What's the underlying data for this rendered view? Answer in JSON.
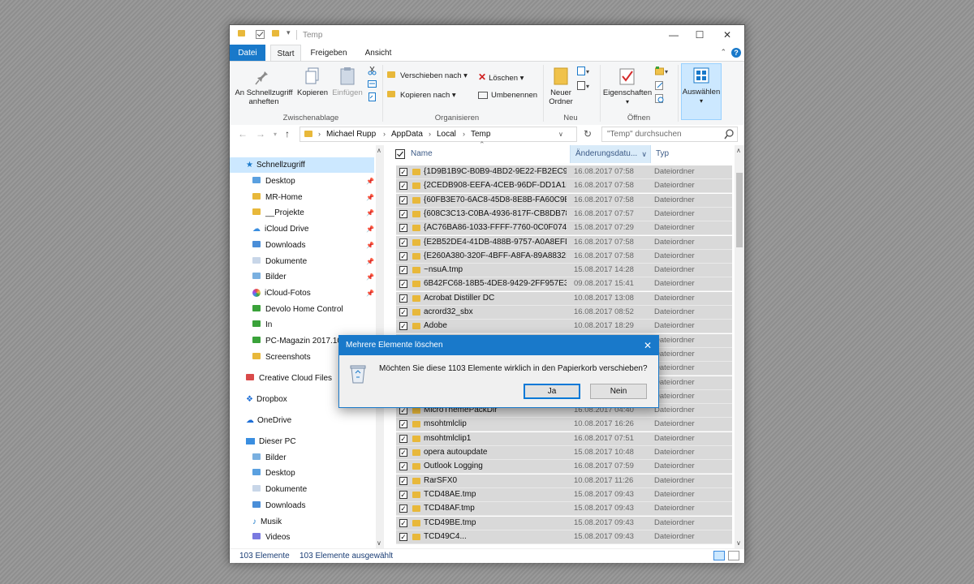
{
  "window": {
    "title": "Temp",
    "buttons": {
      "minimize": "—",
      "maximize": "☐",
      "close": "✕"
    }
  },
  "ribbon": {
    "tabs": [
      "Datei",
      "Start",
      "Freigeben",
      "Ansicht"
    ],
    "active_tab": "Start",
    "clipboard": {
      "pin_label_1": "An Schnellzugriff",
      "pin_label_2": "anheften",
      "copy": "Kopieren",
      "paste": "Einfügen",
      "group": "Zwischenablage"
    },
    "organize": {
      "move_to": "Verschieben nach",
      "copy_to": "Kopieren nach",
      "delete": "Löschen",
      "rename": "Umbenennen",
      "group": "Organisieren"
    },
    "new": {
      "new_folder_1": "Neuer",
      "new_folder_2": "Ordner",
      "group": "Neu"
    },
    "open": {
      "properties": "Eigenschaften",
      "group": "Öffnen"
    },
    "select": {
      "select": "Auswählen"
    }
  },
  "address": {
    "breadcrumbs": [
      "Michael Rupp",
      "AppData",
      "Local",
      "Temp"
    ],
    "search_placeholder": "\"Temp\" durchsuchen"
  },
  "nav_pane": {
    "quick_access": "Schnellzugriff",
    "quick_items": [
      "Desktop",
      "MR-Home",
      "__Projekte",
      "iCloud Drive",
      "Downloads",
      "Dokumente",
      "Bilder",
      "iCloud-Fotos",
      "Devolo Home Control",
      "In",
      "PC-Magazin 2017.10",
      "Screenshots"
    ],
    "creative_cloud": "Creative Cloud Files",
    "dropbox": "Dropbox",
    "onedrive": "OneDrive",
    "this_pc": "Dieser PC",
    "pc_items": [
      "Bilder",
      "Desktop",
      "Dokumente",
      "Downloads",
      "Musik",
      "Videos"
    ]
  },
  "columns": {
    "name": "Name",
    "date": "Änderungsdatu...",
    "type": "Typ"
  },
  "files": [
    {
      "name": "{1D9B1B9C-B0B9-4BD2-9E22-FB2EC95...",
      "date": "16.08.2017 07:58",
      "type": "Dateiordner"
    },
    {
      "name": "{2CEDB908-EEFA-4CEB-96DF-DD1A1E...",
      "date": "16.08.2017 07:58",
      "type": "Dateiordner"
    },
    {
      "name": "{60FB3E70-6AC8-45D8-8E8B-FA60C9E...",
      "date": "16.08.2017 07:58",
      "type": "Dateiordner"
    },
    {
      "name": "{608C3C13-C0BA-4936-817F-CB8DB78...",
      "date": "16.08.2017 07:57",
      "type": "Dateiordner"
    },
    {
      "name": "{AC76BA86-1033-FFFF-7760-0C0F074E...",
      "date": "15.08.2017 07:29",
      "type": "Dateiordner"
    },
    {
      "name": "{E2B52DE4-41DB-488B-9757-A0A8EFD...",
      "date": "16.08.2017 07:58",
      "type": "Dateiordner"
    },
    {
      "name": "{E260A380-320F-4BFF-A8FA-89A8832F...",
      "date": "16.08.2017 07:58",
      "type": "Dateiordner"
    },
    {
      "name": "~nsuA.tmp",
      "date": "15.08.2017 14:28",
      "type": "Dateiordner"
    },
    {
      "name": "6B42FC68-18B5-4DE8-9429-2FF957E33...",
      "date": "09.08.2017 15:41",
      "type": "Dateiordner"
    },
    {
      "name": "Acrobat Distiller DC",
      "date": "10.08.2017 13:08",
      "type": "Dateiordner"
    },
    {
      "name": "acrord32_sbx",
      "date": "16.08.2017 08:52",
      "type": "Dateiordner"
    },
    {
      "name": "Adobe",
      "date": "10.08.2017 18:29",
      "type": "Dateiordner"
    },
    {
      "name": "",
      "date": "",
      "type": "Dateiordner"
    },
    {
      "name": "",
      "date": "",
      "type": "Dateiordner"
    },
    {
      "name": "",
      "date": "",
      "type": "Dateiordner"
    },
    {
      "name": "",
      "date": "",
      "type": "Dateiordner"
    },
    {
      "name": "",
      "date": "",
      "type": "Dateiordner"
    },
    {
      "name": "MicroThemePackDir",
      "date": "16.08.2017 04:40",
      "type": "Dateiordner"
    },
    {
      "name": "msohtmlclip",
      "date": "10.08.2017 16:26",
      "type": "Dateiordner"
    },
    {
      "name": "msohtmlclip1",
      "date": "16.08.2017 07:51",
      "type": "Dateiordner"
    },
    {
      "name": "opera autoupdate",
      "date": "15.08.2017 10:48",
      "type": "Dateiordner"
    },
    {
      "name": "Outlook Logging",
      "date": "16.08.2017 07:59",
      "type": "Dateiordner"
    },
    {
      "name": "RarSFX0",
      "date": "10.08.2017 11:26",
      "type": "Dateiordner"
    },
    {
      "name": "TCD48AE.tmp",
      "date": "15.08.2017 09:43",
      "type": "Dateiordner"
    },
    {
      "name": "TCD48AF.tmp",
      "date": "15.08.2017 09:43",
      "type": "Dateiordner"
    },
    {
      "name": "TCD49BE.tmp",
      "date": "15.08.2017 09:43",
      "type": "Dateiordner"
    },
    {
      "name": "TCD49C4...",
      "date": "15.08.2017 09:43",
      "type": "Dateiordner"
    }
  ],
  "status": {
    "count": "103 Elemente",
    "selected": "103 Elemente ausgewählt"
  },
  "dialog": {
    "title": "Mehrere Elemente löschen",
    "message": "Möchten Sie diese 1103 Elemente wirklich in den Papierkorb verschieben?",
    "yes": "Ja",
    "no": "Nein"
  },
  "colors": {
    "accent": "#1979ca",
    "selection": "#cce8ff",
    "row_selected": "#d9d9d9",
    "folder": "#e8b83a"
  }
}
